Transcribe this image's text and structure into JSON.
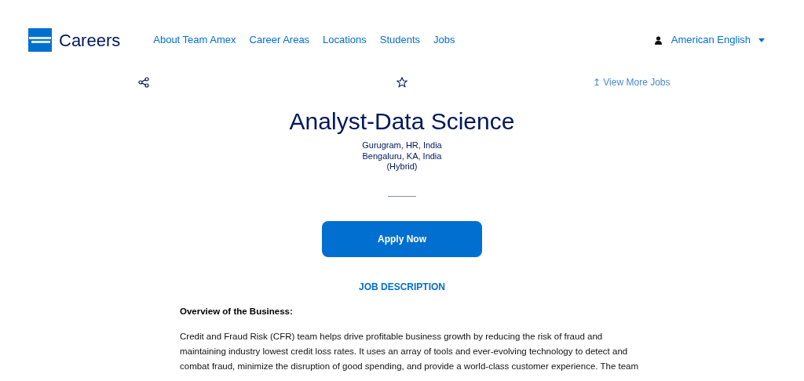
{
  "header": {
    "brand": "Careers",
    "nav": [
      "About Team Amex",
      "Career Areas",
      "Locations",
      "Students",
      "Jobs"
    ],
    "language": "American English"
  },
  "toolbar": {
    "view_more": "↥ View More Jobs"
  },
  "job": {
    "title": "Analyst-Data Science",
    "locations": [
      "Gurugram, HR, India",
      "Bengaluru, KA, India",
      "(Hybrid)"
    ],
    "apply": "Apply Now"
  },
  "description": {
    "heading": "JOB DESCRIPTION",
    "subheading": "Overview of the Business:",
    "paragraph_lines": [
      "Credit and Fraud Risk (CFR) team helps drive profitable business growth by reducing the risk of fraud and",
      "maintaining industry lowest credit loss rates. It uses an array of tools and ever-evolving technology to detect and",
      "combat fraud, minimize the disruption of good spending, and provide a world-class customer experience. The team"
    ]
  }
}
